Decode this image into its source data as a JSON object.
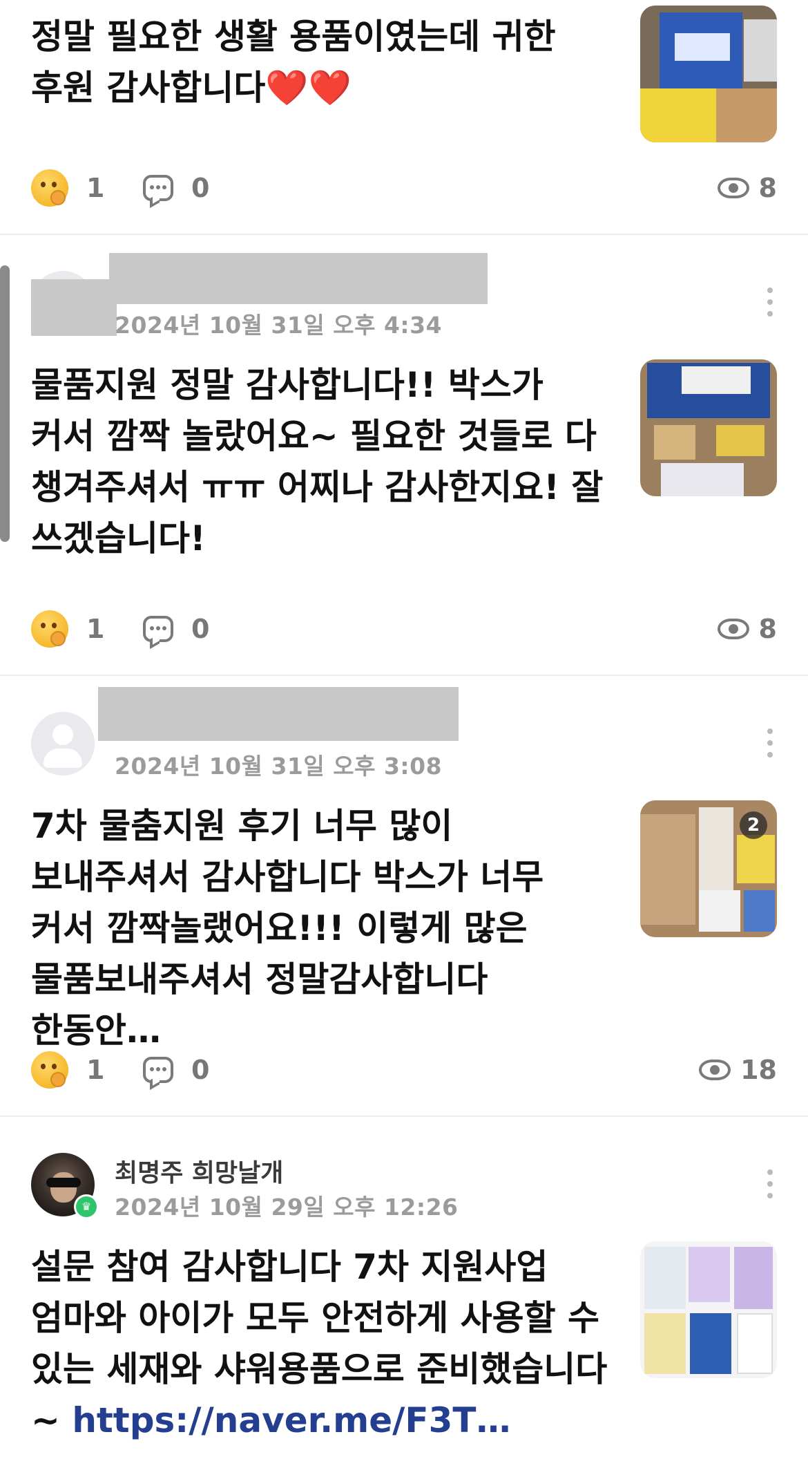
{
  "posts": [
    {
      "text": "정말 필요한 생활 용품이였는데 귀한 후원 감사합니다❤️❤️",
      "reactions": "1",
      "comments": "0",
      "views": "8"
    },
    {
      "date": "2024년 10월 31일 오후 4:34",
      "text": "물품지원 정말 감사합니다!! 박스가 커서 깜짝 놀랐어요~ 필요한 것들로 다 챙겨주셔서 ㅠㅠ 어찌나 감사한지요! 잘 쓰겠습니다!",
      "reactions": "1",
      "comments": "0",
      "views": "8"
    },
    {
      "date": "2024년 10월 31일 오후 3:08",
      "text": "7차 물춤지원 후기 너무 많이 보내주셔서 감사합니다 박스가 너무 커서 깜짝놀랬어요!!! 이렇게 많은 물품보내주셔서 정말감사합니다 한동안…",
      "image_count": "2",
      "reactions": "1",
      "comments": "0",
      "views": "18"
    },
    {
      "author": "최명주 희망날개",
      "date": "2024년 10월 29일 오후 12:26",
      "text": "설문 참여 감사합니다 7차 지원사업 엄마와 아이가 모두 안전하게 사용할 수 있는 세재와 샤워용품으로 준비했습니다~ ",
      "link": "https://naver.me/F3T…"
    }
  ],
  "colors": {
    "link": "#243f8f",
    "meta": "#9b9b9b",
    "badge": "#2fc56b"
  }
}
